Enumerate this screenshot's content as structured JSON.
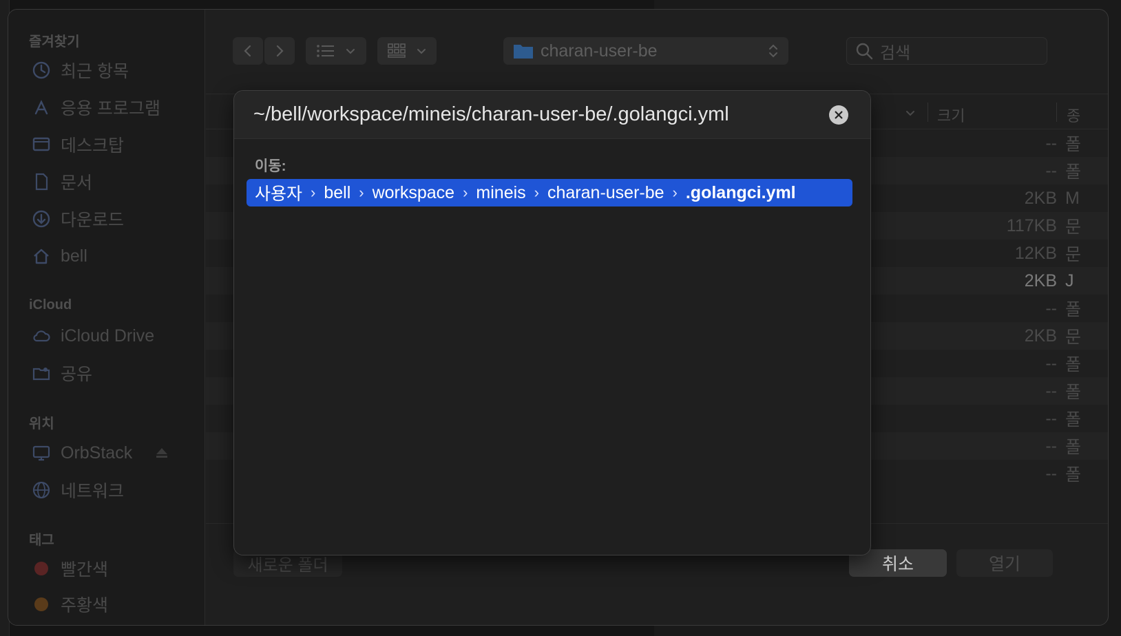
{
  "sidebar": {
    "sections": {
      "favorites": "즐겨찾기",
      "icloud": "iCloud",
      "locations": "위치",
      "tags": "태그"
    },
    "favorites": [
      {
        "label": "최근 항목",
        "icon": "clock-icon"
      },
      {
        "label": "응용 프로그램",
        "icon": "applications-icon"
      },
      {
        "label": "데스크탑",
        "icon": "desktop-icon"
      },
      {
        "label": "문서",
        "icon": "document-icon"
      },
      {
        "label": "다운로드",
        "icon": "download-icon"
      },
      {
        "label": "bell",
        "icon": "home-icon"
      }
    ],
    "icloud": [
      {
        "label": "iCloud Drive",
        "icon": "cloud-icon"
      },
      {
        "label": "공유",
        "icon": "shared-folder-icon"
      }
    ],
    "locations": [
      {
        "label": "OrbStack",
        "icon": "computer-icon"
      },
      {
        "label": "네트워크",
        "icon": "globe-icon"
      }
    ],
    "tags": [
      {
        "label": "빨간색",
        "color": "#c93a3a"
      },
      {
        "label": "주황색",
        "color": "#c47a2a"
      }
    ]
  },
  "toolbar": {
    "path_popup": "charan-user-be",
    "search_placeholder": "검색"
  },
  "list": {
    "size_header": "크기",
    "kind_header": "종",
    "rows": [
      {
        "size": "--",
        "kind": "폴"
      },
      {
        "size": "--",
        "kind": "폴"
      },
      {
        "size": "2KB",
        "kind": "M"
      },
      {
        "size": "117KB",
        "kind": "문"
      },
      {
        "size": "12KB",
        "kind": "문"
      },
      {
        "size": "2KB",
        "kind": "J"
      },
      {
        "size": "--",
        "kind": "폴"
      },
      {
        "size": "2KB",
        "kind": "문"
      },
      {
        "size": "--",
        "kind": "폴"
      },
      {
        "size": "--",
        "kind": "폴"
      },
      {
        "size": "--",
        "kind": "폴"
      },
      {
        "size": "--",
        "kind": "폴"
      },
      {
        "size": "--",
        "kind": "폴"
      }
    ]
  },
  "footer": {
    "new_folder": "새로운 폴더",
    "cancel": "취소",
    "open": "열기"
  },
  "goto_sheet": {
    "path_input": "~/bell/workspace/mineis/charan-user-be/.golangci.yml",
    "label": "이동:",
    "breadcrumbs": [
      "사용자",
      "bell",
      "workspace",
      "mineis",
      "charan-user-be",
      ".golangci.yml"
    ],
    "separator": "›"
  },
  "colors": {
    "accent": "#1f55d6",
    "folder": "#2d6fb3"
  }
}
